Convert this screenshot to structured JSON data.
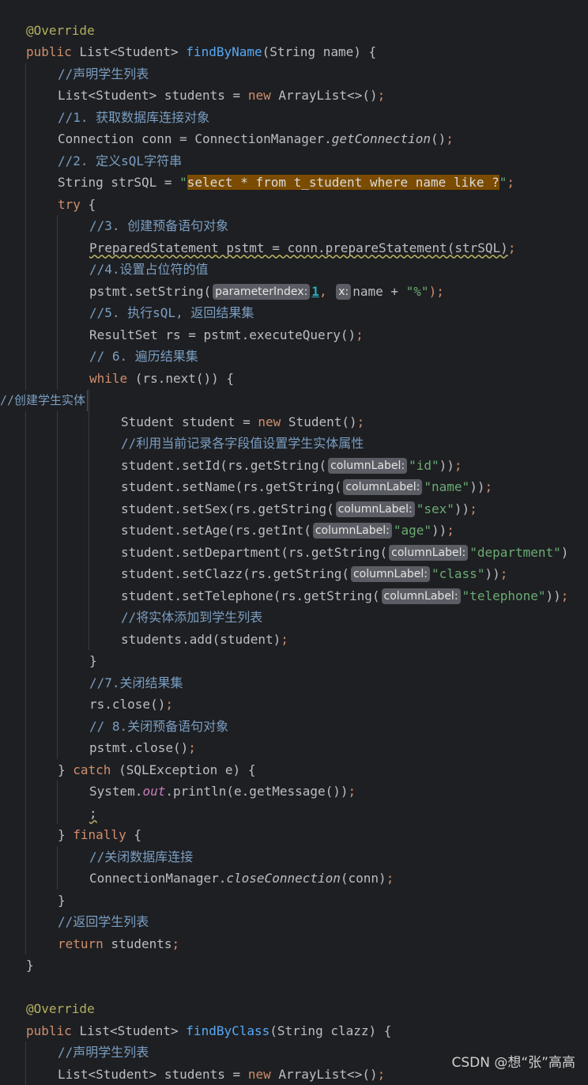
{
  "editor": {
    "lines": [
      {
        "indent": 0,
        "tokens": []
      },
      {
        "indent": 1,
        "tokens": [
          {
            "t": "@Override",
            "k": "ann"
          }
        ]
      },
      {
        "indent": 1,
        "tokens": [
          {
            "t": "public ",
            "k": "kw"
          },
          {
            "t": "List<Student> "
          },
          {
            "t": "findByName",
            "k": "fn"
          },
          {
            "t": "(String name) {"
          }
        ]
      },
      {
        "indent": 2,
        "tokens": [
          {
            "t": "//声明学生列表",
            "k": "cmt"
          }
        ]
      },
      {
        "indent": 2,
        "tokens": [
          {
            "t": "List<Student> students = "
          },
          {
            "t": "new ",
            "k": "kw"
          },
          {
            "t": "ArrayList<>()"
          },
          {
            "t": ";",
            "k": "kw"
          }
        ]
      },
      {
        "indent": 2,
        "tokens": [
          {
            "t": "//1. 获取数据库连接对象",
            "k": "cmt"
          }
        ]
      },
      {
        "indent": 2,
        "tokens": [
          {
            "t": "Connection conn = ConnectionManager."
          },
          {
            "t": "getConnection",
            "k": "smeth"
          },
          {
            "t": "()"
          },
          {
            "t": ";",
            "k": "kw"
          }
        ]
      },
      {
        "indent": 2,
        "tokens": [
          {
            "t": "//2. 定义sQL字符串",
            "k": "cmt"
          }
        ]
      },
      {
        "indent": 2,
        "tokens": [
          {
            "t": "String strSQL = "
          },
          {
            "t": "\"",
            "k": "str"
          },
          {
            "t": "select * from t_student where name like ?",
            "k": "hl"
          },
          {
            "t": "\"",
            "k": "str"
          },
          {
            "t": ";",
            "k": "kw"
          }
        ]
      },
      {
        "indent": 2,
        "tokens": [
          {
            "t": "try ",
            "k": "kw"
          },
          {
            "t": "{"
          }
        ]
      },
      {
        "indent": 3,
        "tokens": [
          {
            "t": "//3. 创建预备语句对象",
            "k": "cmt"
          }
        ]
      },
      {
        "indent": 3,
        "tokens": [
          {
            "t": "PreparedStatement pstmt = conn.prepareStatement(strSQL)",
            "k": "warn"
          },
          {
            "t": ";",
            "k": "kw"
          }
        ]
      },
      {
        "indent": 3,
        "tokens": [
          {
            "t": "//4.设置占位符的值",
            "k": "cmt"
          }
        ]
      },
      {
        "indent": 3,
        "tokens": [
          {
            "t": "pstmt.setString("
          },
          {
            "t": "parameterIndex:",
            "k": "hint"
          },
          {
            "t": "1",
            "k": "num"
          },
          {
            "t": ", ",
            "k": "kw"
          },
          {
            "t": "x:",
            "k": "hint"
          },
          {
            "t": "name + "
          },
          {
            "t": "\"%\"",
            "k": "str"
          },
          {
            "t": ");",
            "k": "kw"
          }
        ]
      },
      {
        "indent": 3,
        "tokens": [
          {
            "t": "//5. 执行sQL, 返回结果集",
            "k": "cmt"
          }
        ]
      },
      {
        "indent": 3,
        "tokens": [
          {
            "t": "ResultSet rs = pstmt.executeQuery()"
          },
          {
            "t": ";",
            "k": "kw"
          }
        ]
      },
      {
        "indent": 3,
        "tokens": [
          {
            "t": "// 6. 遍历结果集",
            "k": "cmt"
          }
        ]
      },
      {
        "indent": 3,
        "tokens": [
          {
            "t": "while ",
            "k": "kw"
          },
          {
            "t": "(rs.next()) {"
          }
        ]
      },
      {
        "indent": 4,
        "tokens": []
      },
      {
        "indent": 4,
        "tokens": [
          {
            "t": "Student student = "
          },
          {
            "t": "new ",
            "k": "kw"
          },
          {
            "t": "Student()"
          },
          {
            "t": ";",
            "k": "kw"
          }
        ]
      },
      {
        "indent": 4,
        "tokens": [
          {
            "t": "//利用当前记录各字段值设置学生实体属性",
            "k": "cmt"
          }
        ]
      },
      {
        "indent": 4,
        "tokens": [
          {
            "t": "student.setId(rs.getString("
          },
          {
            "t": "columnLabel:",
            "k": "hint"
          },
          {
            "t": "\"id\"",
            "k": "str"
          },
          {
            "t": "))"
          },
          {
            "t": ";",
            "k": "kw"
          }
        ]
      },
      {
        "indent": 4,
        "tokens": [
          {
            "t": "student.setName(rs.getString("
          },
          {
            "t": "columnLabel:",
            "k": "hint"
          },
          {
            "t": "\"name\"",
            "k": "str"
          },
          {
            "t": "))"
          },
          {
            "t": ";",
            "k": "kw"
          }
        ]
      },
      {
        "indent": 4,
        "tokens": [
          {
            "t": "student.setSex(rs.getString("
          },
          {
            "t": "columnLabel:",
            "k": "hint"
          },
          {
            "t": "\"sex\"",
            "k": "str"
          },
          {
            "t": "))"
          },
          {
            "t": ";",
            "k": "kw"
          }
        ]
      },
      {
        "indent": 4,
        "tokens": [
          {
            "t": "student.setAge(rs.getInt("
          },
          {
            "t": "columnLabel:",
            "k": "hint"
          },
          {
            "t": "\"age\"",
            "k": "str"
          },
          {
            "t": "))"
          },
          {
            "t": ";",
            "k": "kw"
          }
        ]
      },
      {
        "indent": 4,
        "tokens": [
          {
            "t": "student.setDepartment(rs.getString("
          },
          {
            "t": "columnLabel:",
            "k": "hint"
          },
          {
            "t": "\"department\"",
            "k": "str"
          },
          {
            "t": ")"
          }
        ]
      },
      {
        "indent": 4,
        "tokens": [
          {
            "t": "student.setClazz(rs.getString("
          },
          {
            "t": "columnLabel:",
            "k": "hint"
          },
          {
            "t": "\"class\"",
            "k": "str"
          },
          {
            "t": "))"
          },
          {
            "t": ";",
            "k": "kw"
          }
        ]
      },
      {
        "indent": 4,
        "tokens": [
          {
            "t": "student.setTelephone(rs.getString("
          },
          {
            "t": "columnLabel:",
            "k": "hint"
          },
          {
            "t": "\"telephone\"",
            "k": "str"
          },
          {
            "t": "))"
          },
          {
            "t": ";",
            "k": "kw"
          }
        ]
      },
      {
        "indent": 4,
        "tokens": [
          {
            "t": "//将实体添加到学生列表",
            "k": "cmt"
          }
        ]
      },
      {
        "indent": 4,
        "tokens": [
          {
            "t": "students.add(student)"
          },
          {
            "t": ";",
            "k": "kw"
          }
        ]
      },
      {
        "indent": 3,
        "tokens": [
          {
            "t": "}"
          }
        ]
      },
      {
        "indent": 3,
        "tokens": [
          {
            "t": "//7.关闭结果集",
            "k": "cmt"
          }
        ]
      },
      {
        "indent": 3,
        "tokens": [
          {
            "t": "rs.close()"
          },
          {
            "t": ";",
            "k": "kw"
          }
        ]
      },
      {
        "indent": 3,
        "tokens": [
          {
            "t": "// 8.关闭预备语句对象",
            "k": "cmt"
          }
        ]
      },
      {
        "indent": 3,
        "tokens": [
          {
            "t": "pstmt.close()"
          },
          {
            "t": ";",
            "k": "kw"
          }
        ]
      },
      {
        "indent": 2,
        "tokens": [
          {
            "t": "} "
          },
          {
            "t": "catch ",
            "k": "kw"
          },
          {
            "t": "(SQLException e) {"
          }
        ]
      },
      {
        "indent": 3,
        "tokens": [
          {
            "t": "System."
          },
          {
            "t": "out",
            "k": "sfld"
          },
          {
            "t": ".println(e.getMessage())"
          },
          {
            "t": ";",
            "k": "kw"
          }
        ]
      },
      {
        "indent": 3,
        "tokens": [
          {
            "t": ";",
            "k": "warn"
          }
        ]
      },
      {
        "indent": 2,
        "tokens": [
          {
            "t": "} "
          },
          {
            "t": "finally ",
            "k": "kw"
          },
          {
            "t": "{"
          }
        ]
      },
      {
        "indent": 3,
        "tokens": [
          {
            "t": "//关闭数据库连接",
            "k": "cmt"
          }
        ]
      },
      {
        "indent": 3,
        "tokens": [
          {
            "t": "ConnectionManager."
          },
          {
            "t": "closeConnection",
            "k": "smeth"
          },
          {
            "t": "(conn)"
          },
          {
            "t": ";",
            "k": "kw"
          }
        ]
      },
      {
        "indent": 2,
        "tokens": [
          {
            "t": "}"
          }
        ]
      },
      {
        "indent": 2,
        "tokens": [
          {
            "t": "//返回学生列表",
            "k": "cmt"
          }
        ]
      },
      {
        "indent": 2,
        "tokens": [
          {
            "t": "return ",
            "k": "kw"
          },
          {
            "t": "students"
          },
          {
            "t": ";",
            "k": "kw"
          }
        ]
      },
      {
        "indent": 1,
        "tokens": [
          {
            "t": "}"
          }
        ]
      },
      {
        "indent": 0,
        "tokens": []
      },
      {
        "indent": 1,
        "tokens": [
          {
            "t": "@Override",
            "k": "ann"
          }
        ]
      },
      {
        "indent": 1,
        "tokens": [
          {
            "t": "public ",
            "k": "kw"
          },
          {
            "t": "List<Student> "
          },
          {
            "t": "findByClass",
            "k": "fn"
          },
          {
            "t": "(String clazz) {"
          }
        ]
      },
      {
        "indent": 2,
        "tokens": [
          {
            "t": "//声明学生列表",
            "k": "cmt"
          }
        ]
      },
      {
        "indent": 2,
        "tokens": [
          {
            "t": "List<Student> students = "
          },
          {
            "t": "new ",
            "k": "kw"
          },
          {
            "t": "ArrayList<>()"
          },
          {
            "t": ";",
            "k": "kw"
          }
        ]
      }
    ]
  },
  "floating_comment": "//创建学生实体",
  "watermark": "CSDN @想“张”高高",
  "colors": {
    "background": "#1e1f22",
    "keyword": "#cf8e6d",
    "annotation": "#b3ae60",
    "function": "#56a8f5",
    "comment": "#7a9ec2",
    "string": "#6aab73",
    "static_field": "#c77dbb",
    "highlight": "#7a4b00",
    "hint": "#5a5d63"
  }
}
